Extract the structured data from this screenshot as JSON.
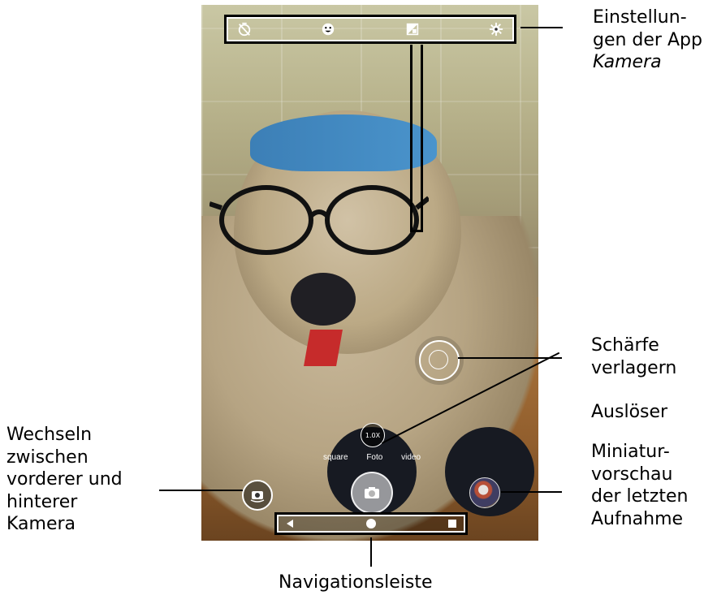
{
  "zoom_label": "1.0X",
  "modes": [
    "square",
    "Foto",
    "video"
  ],
  "annotations": {
    "settings": {
      "line1": "Einstellun-",
      "line2": "gen der App",
      "line3": "Kamera"
    },
    "focus": {
      "line1": "Schärfe",
      "line2": "verlagern"
    },
    "shutter": "Auslöser",
    "thumbnail": {
      "line1": "Miniatur-",
      "line2": "vorschau",
      "line3": "der letzten",
      "line4": "Aufnahme"
    },
    "switch": {
      "line1": "Wechseln",
      "line2": "zwischen",
      "line3": "vorderer und",
      "line4": "hinterer",
      "line5": "Kamera"
    },
    "navbar": "Navigationsleiste"
  },
  "icons": {
    "timer_off": "timer-off-icon",
    "face": "face-icon",
    "hdr": "hdr-icon",
    "settings": "gear-icon",
    "shutter": "camera-icon",
    "switch_camera": "switch-camera-icon",
    "nav_back": "back-triangle-icon",
    "nav_home": "home-circle-icon",
    "nav_recents": "recents-square-icon"
  },
  "colors": {
    "annotation_line": "#000000",
    "ui_white": "#ffffff"
  }
}
